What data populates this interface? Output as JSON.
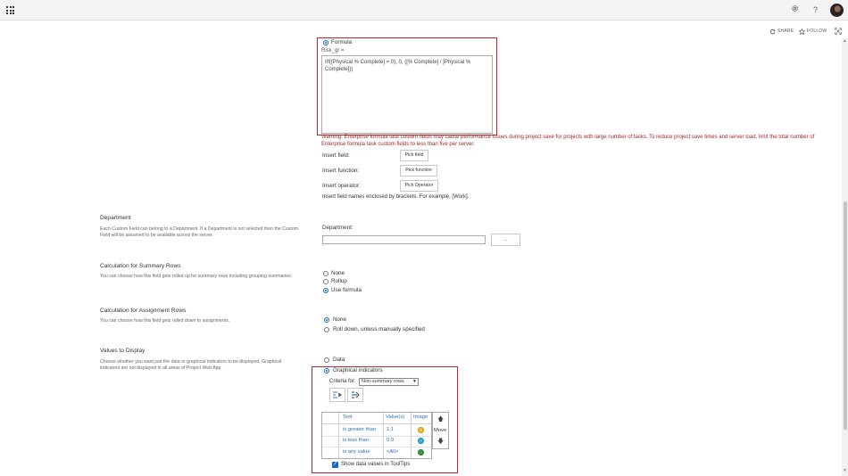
{
  "suite_bar": {
    "app_launcher_icon": "waffle-icon",
    "settings_icon": "gear-icon",
    "help_icon": "question-icon",
    "help_glyph": "?"
  },
  "action_bar": {
    "share_label": "SHARE",
    "follow_label": "FOLLOW",
    "share_icon": "share-icon",
    "follow_icon": "star-icon",
    "focus_icon": "focus-icon"
  },
  "formula": {
    "option_label": "Formula",
    "field_prefix": "Risk_gr =",
    "expression": "IIf([Physical % Complete] = 0), 0, ([% Complete] / [Physical % Complete]))",
    "warning": "Warning: Enterprise formula task custom fields may cause performance issues during project save for projects with large number of tasks. To reduce project save times and server load, limit the total number of Enterprise formula task custom fields to less than five per server.",
    "insert_field_label": "Insert field:",
    "insert_function_label": "Insert function:",
    "insert_operator_label": "Insert operator:",
    "pick_field_button": "Pick field",
    "pick_function_button": "Pick function",
    "pick_operator_button": "Pick Operator",
    "hint": "Insert field names enclosed by brackets. For example, [Work]."
  },
  "department": {
    "title": "Department",
    "description": "Each Custom Field can belong to a Department. If a Department is not selected then the Custom Field will be assumed to be available across the server.",
    "field_label": "Department:",
    "value": "",
    "browse_button": "..."
  },
  "summary_rows": {
    "title": "Calculation for Summary Rows",
    "description": "You can choose how this field gets rolled up for summary rows including grouping summaries.",
    "options": [
      "None",
      "Rollup",
      "Use formula"
    ],
    "selected": "Use formula"
  },
  "assignment_rows": {
    "title": "Calculation for Assignment Rows",
    "description": "You can choose how this field gets rolled down to assignments.",
    "options": [
      "None",
      "Roll down, unless manually specified"
    ],
    "selected": "None"
  },
  "values_to_display": {
    "title": "Values to Display",
    "description": "Choose whether you want just the data or graphical indicators to be displayed. Graphical indicators are not displayed in all areas of Project Web App.",
    "options": [
      "Data",
      "Graphical indicators"
    ],
    "selected": "Graphical indicators",
    "criteria_label": "Criteria for:",
    "criteria_value": "Non-summary rows",
    "table_headers": {
      "test": "Test",
      "value": "Value(s)",
      "image": "Image"
    },
    "rows": [
      {
        "test": "is greater than",
        "value": "1.1",
        "image_color": "#f2c430",
        "image_icon": "yellow-circle-icon"
      },
      {
        "test": "is less than",
        "value": "0.9",
        "image_color": "#38b5d8",
        "image_icon": "blue-circle-icon"
      },
      {
        "test": "is any value",
        "value": "<All>",
        "image_color": "#3a9b48",
        "image_icon": "green-circle-icon"
      }
    ],
    "move_label": "Move",
    "show_tooltips_label": "Show data values in ToolTips",
    "show_tooltips_checked": true
  },
  "colors": {
    "highlight_border": "#c4262e",
    "warning_text": "#a4262c",
    "link": "#2a6ebb",
    "selected_radio": "#0b6bc6"
  }
}
